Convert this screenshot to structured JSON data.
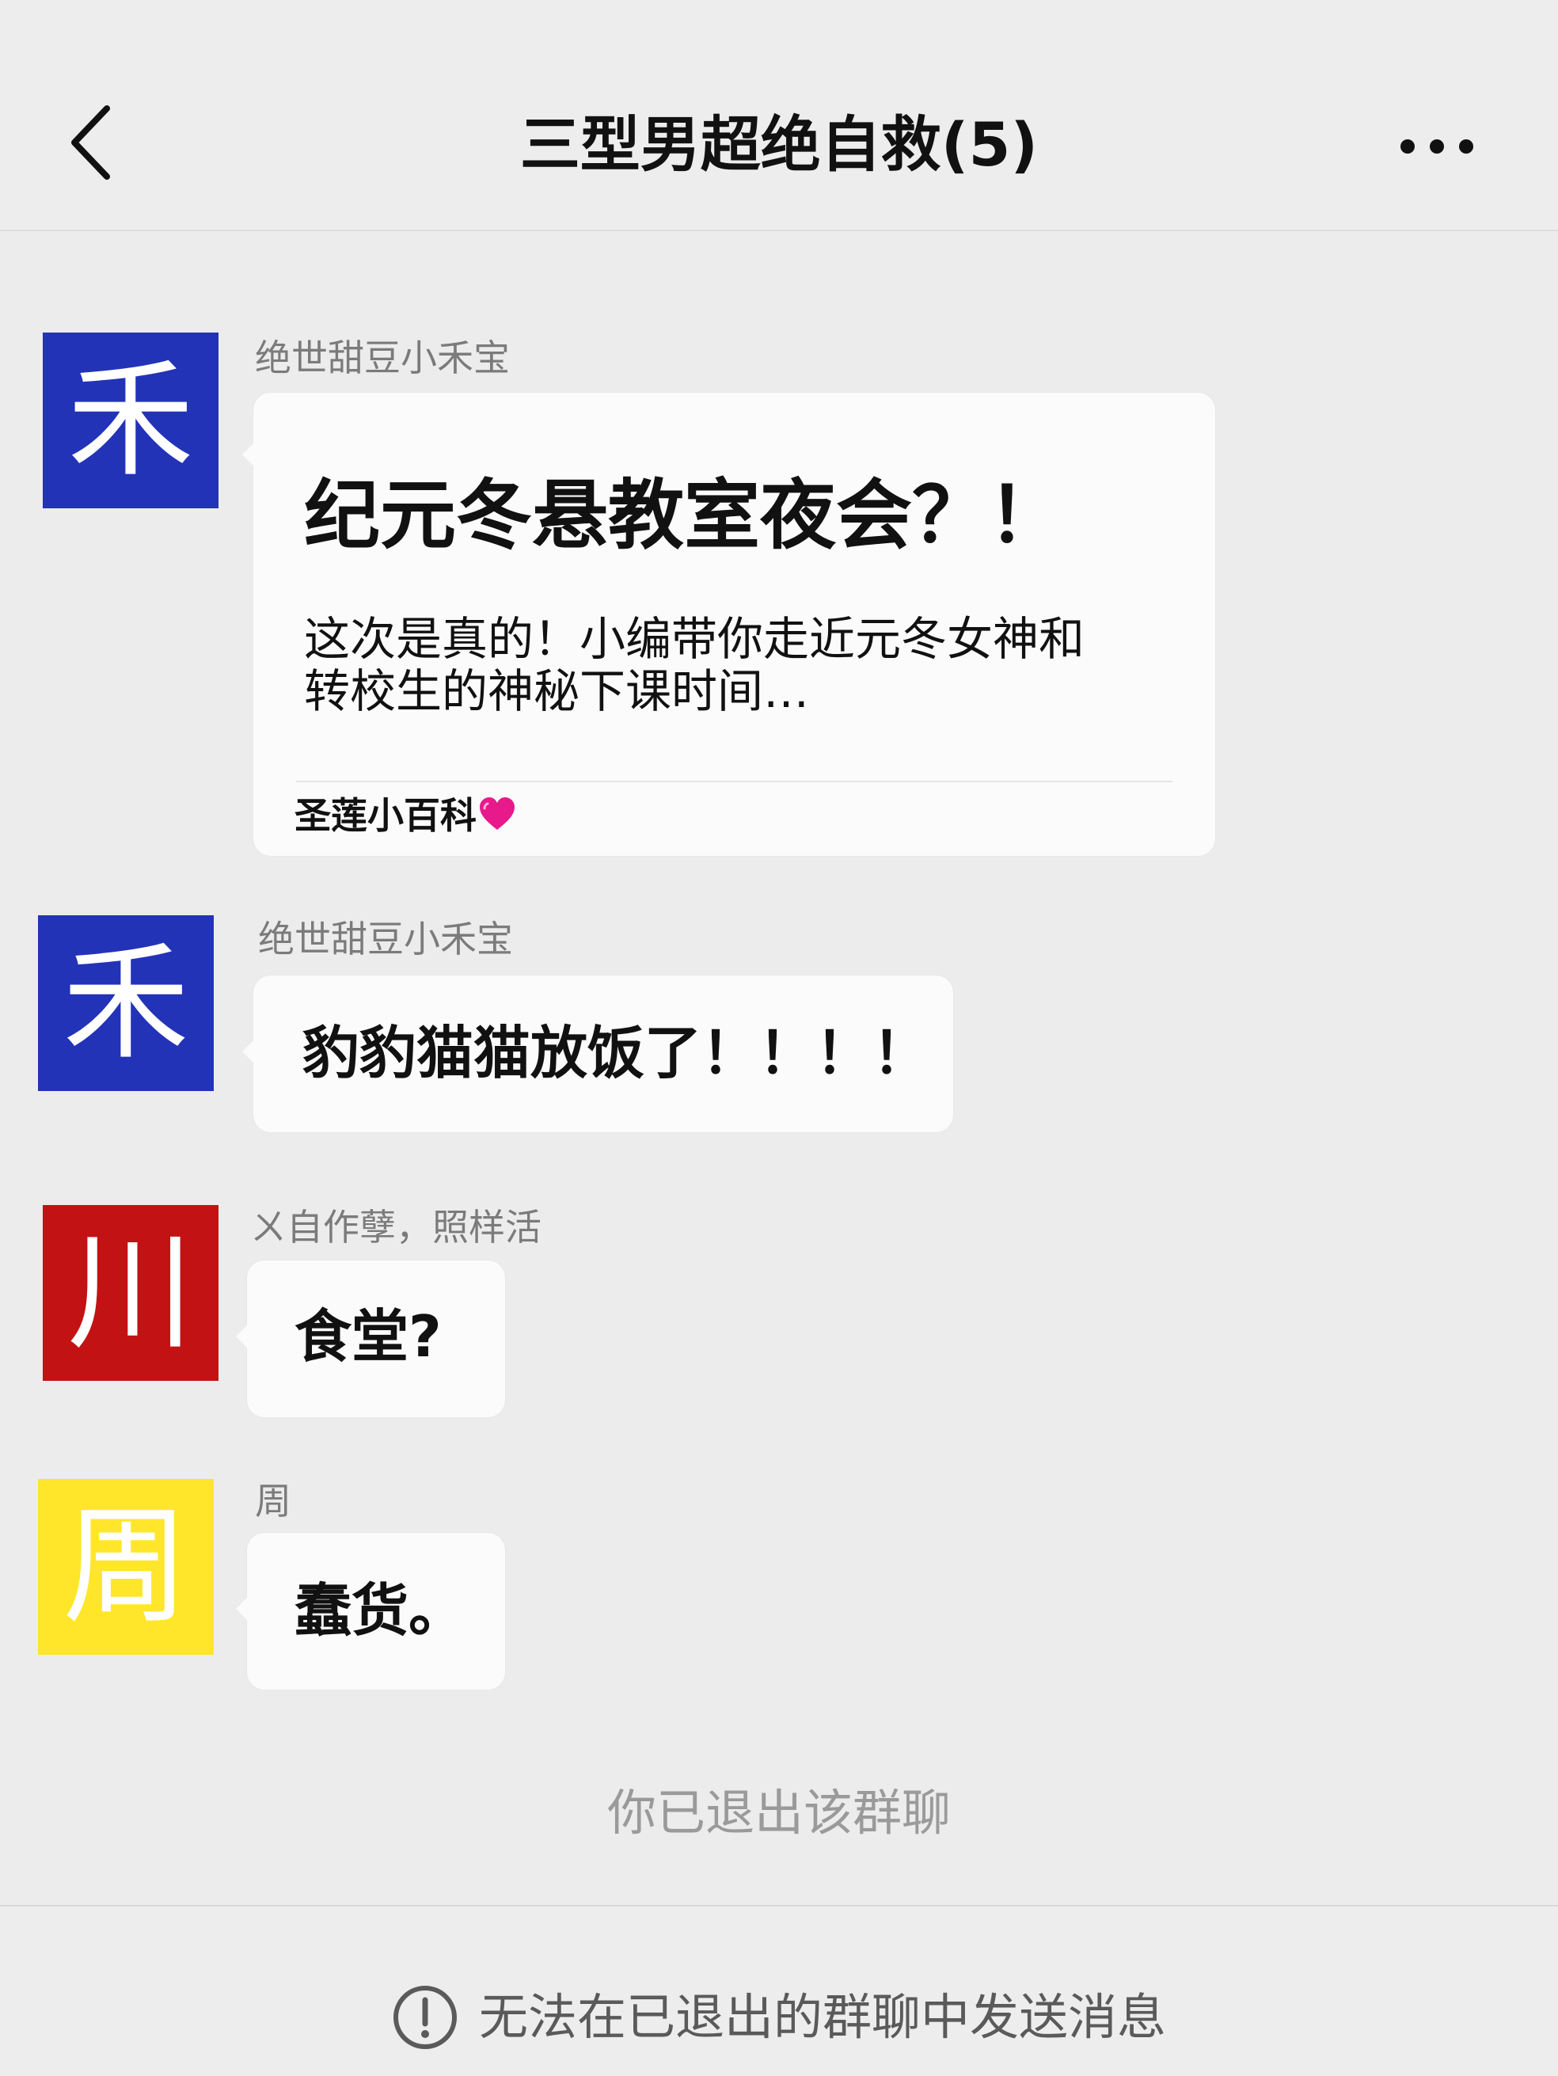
{
  "header": {
    "title": "三型男超绝自救(5)"
  },
  "messages": [
    {
      "sender": "绝世甜豆小禾宝",
      "avatar_char": "禾",
      "avatar_color": "#2233b8",
      "card": {
        "title": "纪元冬悬教室夜会？！",
        "description": "这次是真的！小编带你走近元冬女神和转校生的神秘下课时间…",
        "source": "圣莲小百科"
      }
    },
    {
      "sender": "绝世甜豆小禾宝",
      "avatar_char": "禾",
      "avatar_color": "#2233b8",
      "text": "豹豹猫猫放饭了！！！！"
    },
    {
      "sender": "ㄨ自作孽，照样活",
      "avatar_char": "川",
      "avatar_color": "#c31213",
      "text": "食堂?"
    },
    {
      "sender": "周",
      "avatar_char": "周",
      "avatar_color": "#ffe62a",
      "text": "蠢货。"
    }
  ],
  "system_notice": "你已退出该群聊",
  "footer": {
    "notice": "无法在已退出的群聊中发送消息"
  }
}
